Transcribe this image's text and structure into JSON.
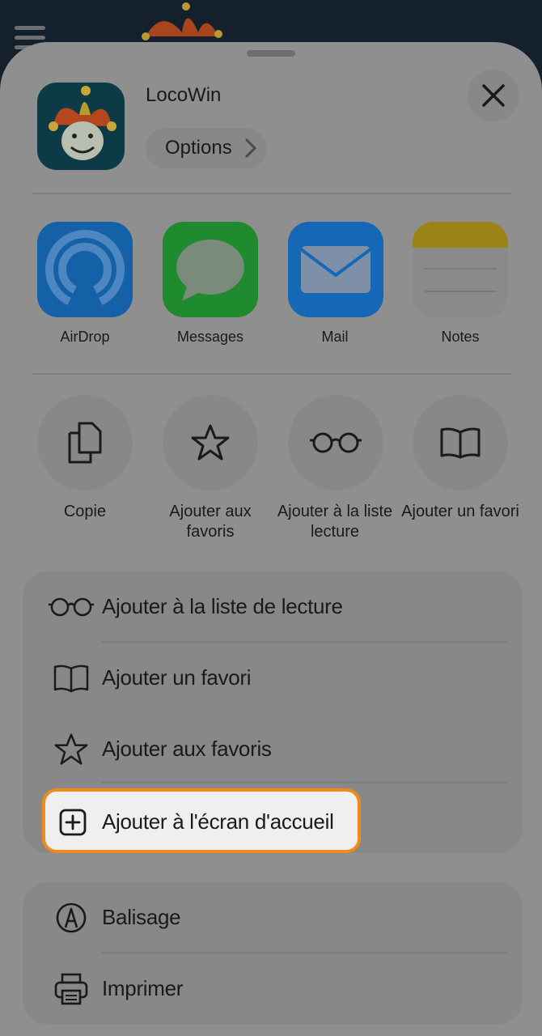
{
  "header": {
    "app_name": "LocoWin",
    "options_label": "Options"
  },
  "apps": [
    {
      "label": "AirDrop",
      "icon": "airdrop-icon"
    },
    {
      "label": "Messages",
      "icon": "messages-icon"
    },
    {
      "label": "Mail",
      "icon": "mail-icon"
    },
    {
      "label": "Notes",
      "icon": "notes-icon"
    }
  ],
  "quick_actions": [
    {
      "label": "Copie",
      "icon": "copy-icon"
    },
    {
      "label": "Ajouter aux favoris",
      "icon": "star-icon"
    },
    {
      "label": "Ajouter à la liste lecture",
      "icon": "glasses-icon"
    },
    {
      "label": "Ajouter un favori",
      "icon": "book-icon"
    }
  ],
  "menu_group_1": [
    {
      "label": "Ajouter à la liste de lecture",
      "icon": "glasses-icon"
    },
    {
      "label": "Ajouter un favori",
      "icon": "book-icon"
    },
    {
      "label": "Ajouter aux favoris",
      "icon": "star-icon"
    },
    {
      "label": "Ajouter à l'écran d'accueil",
      "icon": "plus-square-icon",
      "highlighted": true
    }
  ],
  "menu_group_2": [
    {
      "label": "Balisage",
      "icon": "markup-icon"
    },
    {
      "label": "Imprimer",
      "icon": "printer-icon"
    }
  ],
  "colors": {
    "highlight_border": "#f08a1c",
    "sheet_background": "#8f8f8f"
  }
}
